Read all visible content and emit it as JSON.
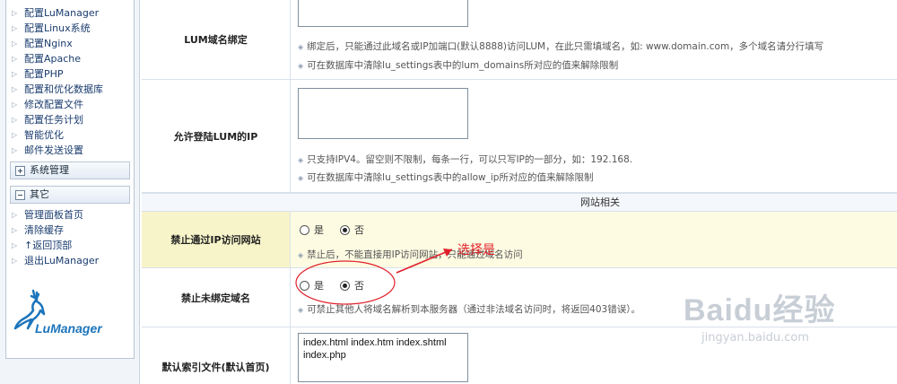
{
  "sidebar": {
    "items_top": [
      {
        "label": "配置LuManager"
      },
      {
        "label": "配置Linux系统"
      },
      {
        "label": "配置Nginx"
      },
      {
        "label": "配置Apache"
      },
      {
        "label": "配置PHP"
      },
      {
        "label": "配置和优化数据库"
      },
      {
        "label": "修改配置文件"
      },
      {
        "label": "配置任务计划"
      },
      {
        "label": "智能优化"
      },
      {
        "label": "邮件发送设置"
      }
    ],
    "section_system": "系统管理",
    "section_other": "其它",
    "items_other": [
      {
        "label": "管理面板首页"
      },
      {
        "label": "清除缓存"
      },
      {
        "label": "↑返回顶部"
      },
      {
        "label": "退出LuManager"
      }
    ],
    "logo_text": "LuManager"
  },
  "form": {
    "lum_domain": {
      "label": "LUM域名绑定",
      "value": "",
      "hint1": "绑定后，只能通过此域名或IP加端口(默认8888)访问LUM，在此只需填域名，如: www.domain.com，多个域名请分行填写",
      "hint2": "可在数据库中清除lu_settings表中的lum_domains所对应的值来解除限制"
    },
    "allow_ip": {
      "label": "允许登陆LUM的IP",
      "value": "",
      "hint1": "只支持IPV4。留空则不限制，每条一行，可以只写IP的一部分，如：192.168.",
      "hint2": "可在数据库中清除lu_settings表中的allow_ip所对应的值来解除限制"
    },
    "section_website": "网站相关",
    "deny_ip_access": {
      "label": "禁止通过IP访问网站",
      "yes": "是",
      "no": "否",
      "hint": "禁止后，不能直接用IP访问网站，只能通过域名访问"
    },
    "deny_unbound_domain": {
      "label": "禁止未绑定域名",
      "yes": "是",
      "no": "否",
      "hint": "可禁止其他人将域名解析到本服务器（通过非法域名访问时，将返回403错误）。"
    },
    "default_index": {
      "label": "默认索引文件(默认首页)",
      "line1": "index.html index.htm index.shtml",
      "line2": "index.php"
    }
  },
  "annotation": {
    "text": "选择是",
    "color": "#e0202a"
  },
  "watermark": {
    "main": "Baidu经验",
    "sub": "jingyan.baidu.com"
  },
  "colors": {
    "accent": "#1a3c6e",
    "highlight": "#fdfbe2",
    "annotation": "#e0202a"
  }
}
